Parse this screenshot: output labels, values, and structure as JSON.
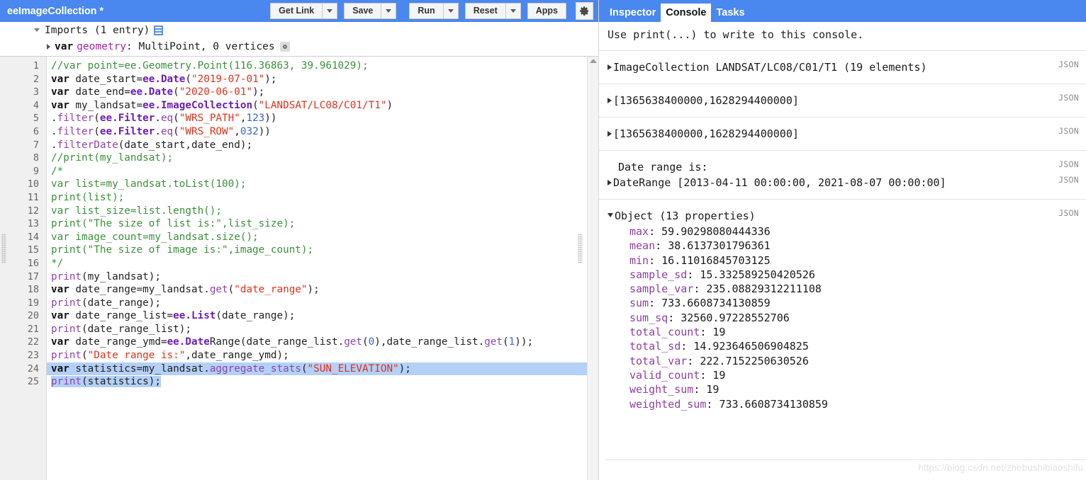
{
  "editor": {
    "script_title": "eeImageCollection *",
    "toolbar": {
      "get_link_label": "Get Link",
      "save_label": "Save",
      "run_label": "Run",
      "reset_label": "Reset",
      "apps_label": "Apps"
    },
    "imports": {
      "header": "Imports (1 entry)",
      "var_keyword": "var",
      "geometry_name": "geometry",
      "geometry_desc": ": MultiPoint, 0 vertices"
    },
    "line_numbers": [
      "1",
      "2",
      "3",
      "4",
      "5",
      "6",
      "7",
      "8",
      "9",
      "10",
      "11",
      "12",
      "13",
      "14",
      "15",
      "16",
      "17",
      "18",
      "19",
      "20",
      "21",
      "22",
      "23",
      "24",
      "25"
    ],
    "code_lines": [
      "//var point=ee.Geometry.Point(116.36863, 39.961029);",
      "var date_start=ee.Date(\"2019-07-01\");",
      "var date_end=ee.Date(\"2020-06-01\");",
      "var my_landsat=ee.ImageCollection(\"LANDSAT/LC08/C01/T1\")",
      ".filter(ee.Filter.eq(\"WRS_PATH\",123))",
      ".filter(ee.Filter.eq(\"WRS_ROW\",032))",
      ".filterDate(date_start,date_end);",
      "//print(my_landsat);",
      "/*",
      "var list=my_landsat.toList(100);",
      "print(list);",
      "var list_size=list.length();",
      "print(\"The size of list is:\",list_size);",
      "var image_count=my_landsat.size();",
      "print(\"The size of image is:\",image_count);",
      "*/",
      "print(my_landsat);",
      "var date_range=my_landsat.get(\"date_range\");",
      "print(date_range);",
      "var date_range_list=ee.List(date_range);",
      "print(date_range_list);",
      "var date_range_ymd=ee.DateRange(date_range_list.get(0),date_range_list.get(1));",
      "print(\"Date range is:\",date_range_ymd);",
      "var statistics=my_landsat.aggregate_stats(\"SUN_ELEVATION\");",
      "print(statistics);"
    ]
  },
  "console": {
    "tabs": [
      {
        "label": "Inspector",
        "active": false
      },
      {
        "label": "Console",
        "active": true
      },
      {
        "label": "Tasks",
        "active": false
      }
    ],
    "hint": "Use print(...) to write to this console.",
    "json_label": "JSON",
    "rows": [
      {
        "text": "ImageCollection LANDSAT/LC08/C01/T1 (19 elements)"
      },
      {
        "text": "[1365638400000,1628294400000]"
      },
      {
        "text": "[1365638400000,1628294400000]"
      },
      {
        "label": "Date range is:",
        "text": "DateRange [2013-04-11 00:00:00, 2021-08-07 00:00:00]"
      }
    ],
    "object_row": {
      "header": "Object (13 properties)",
      "properties": [
        {
          "key": "max",
          "value": "59.90298080444336"
        },
        {
          "key": "mean",
          "value": "38.6137301796361"
        },
        {
          "key": "min",
          "value": "16.11016845703125"
        },
        {
          "key": "sample_sd",
          "value": "15.332589250420526"
        },
        {
          "key": "sample_var",
          "value": "235.08829312211108"
        },
        {
          "key": "sum",
          "value": "733.6608734130859"
        },
        {
          "key": "sum_sq",
          "value": "32560.97228552706"
        },
        {
          "key": "total_count",
          "value": "19"
        },
        {
          "key": "total_sd",
          "value": "14.923646506904825"
        },
        {
          "key": "total_var",
          "value": "222.7152250630526"
        },
        {
          "key": "valid_count",
          "value": "19"
        },
        {
          "key": "weight_sum",
          "value": "19"
        },
        {
          "key": "weighted_sum",
          "value": "733.6608734130859"
        }
      ]
    }
  },
  "watermark": "https://blog.csdn.net/zhebushibiaoshifu",
  "colors": {
    "header_blue": "#4a87ee",
    "active_line": "#b4d0f7",
    "comment_green": "#3b8f3b",
    "string_red": "#e0321a",
    "ee_purple": "#6a1fb5",
    "number_blue": "#3a63d8",
    "prop_key_purple": "#8e3fa0"
  }
}
